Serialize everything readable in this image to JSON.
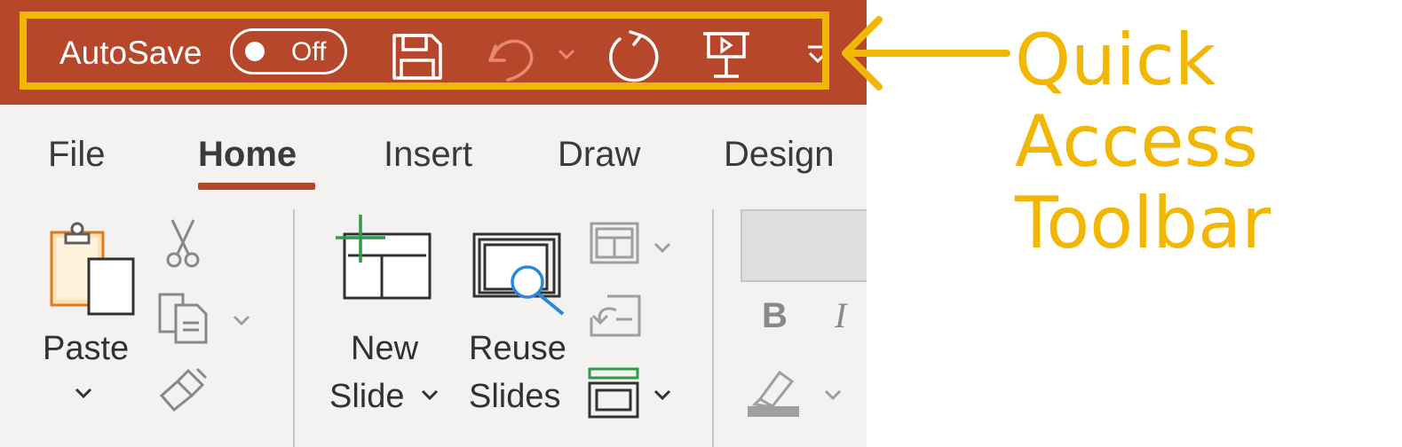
{
  "title_bar": {
    "autosave_label": "AutoSave",
    "autosave_state": "Off",
    "background_color": "#b7472a",
    "icons": [
      "save-icon",
      "undo-icon",
      "undo-dropdown-icon",
      "redo-icon",
      "present-from-beginning-icon",
      "customize-toolbar-icon"
    ]
  },
  "tabs": [
    {
      "label": "File",
      "active": false
    },
    {
      "label": "Home",
      "active": true
    },
    {
      "label": "Insert",
      "active": false
    },
    {
      "label": "Draw",
      "active": false
    },
    {
      "label": "Design",
      "active": false
    }
  ],
  "clipboard": {
    "paste_label": "Paste",
    "icons": [
      "clipboard-icon",
      "cut-icon",
      "copy-icon",
      "format-painter-icon"
    ]
  },
  "slides": {
    "new_slide_label_line1": "New",
    "new_slide_label_line2": "Slide",
    "reuse_slides_label_line1": "Reuse",
    "reuse_slides_label_line2": "Slides",
    "icons": [
      "new-slide-icon",
      "reuse-slides-icon",
      "layout-icon",
      "reset-icon",
      "section-icon"
    ]
  },
  "font": {
    "bold_label": "B",
    "italic_label": "I",
    "icons": [
      "highlighter-icon"
    ]
  },
  "annotation": {
    "lines": [
      "Quick",
      "Access",
      "Toolbar"
    ],
    "color": "#f2b705"
  },
  "colors": {
    "accent": "#b7472a",
    "highlight": "#f2b705",
    "ribbon_background": "#f3f2f1"
  }
}
